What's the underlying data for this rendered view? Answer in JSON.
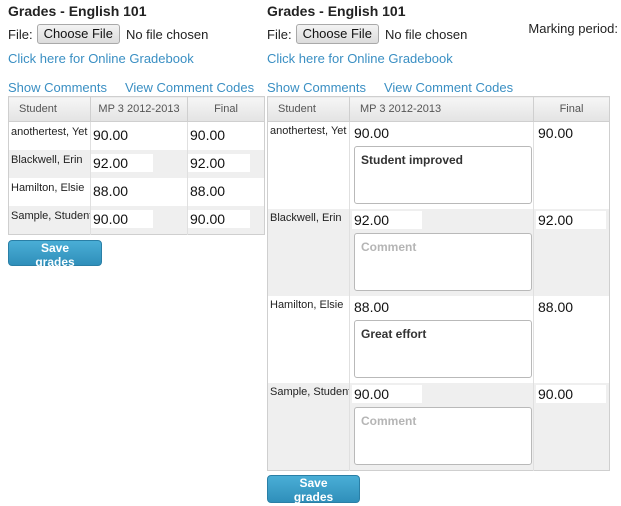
{
  "left": {
    "title": "Grades - English 101",
    "file_label": "File:",
    "choose_file": "Choose File",
    "no_file": "No file chosen",
    "gradebook_link": "Click here for Online Gradebook",
    "show_comments": "Show Comments",
    "view_comment_codes": "View Comment Codes",
    "columns": [
      "Student",
      "MP 3 2012-2013",
      "Final"
    ],
    "rows": [
      {
        "student": "anothertest, Yet",
        "mp": "90.00",
        "final": "90.00"
      },
      {
        "student": "Blackwell, Erin",
        "mp": "92.00",
        "final": "92.00"
      },
      {
        "student": "Hamilton, Elsie",
        "mp": "88.00",
        "final": "88.00"
      },
      {
        "student": "Sample, Student",
        "mp": "90.00",
        "final": "90.00"
      }
    ],
    "save": "Save grades"
  },
  "right": {
    "title": "Grades - English 101",
    "file_label": "File:",
    "choose_file": "Choose File",
    "no_file": "No file chosen",
    "marking_period": "Marking period:",
    "gradebook_link": "Click here for Online Gradebook",
    "show_comments": "Show Comments",
    "view_comment_codes": "View Comment Codes",
    "columns": [
      "Student",
      "MP 3 2012-2013",
      "Final"
    ],
    "comment_placeholder": "Comment",
    "rows": [
      {
        "student": "anothertest, Yet",
        "mp": "90.00",
        "comment": "Student improved",
        "final": "90.00"
      },
      {
        "student": "Blackwell, Erin",
        "mp": "92.00",
        "comment": "",
        "final": "92.00"
      },
      {
        "student": "Hamilton, Elsie",
        "mp": "88.00",
        "comment": "Great effort",
        "final": "88.00"
      },
      {
        "student": "Sample, Student",
        "mp": "90.00",
        "comment": "",
        "final": "90.00"
      }
    ],
    "save": "Save grades"
  }
}
